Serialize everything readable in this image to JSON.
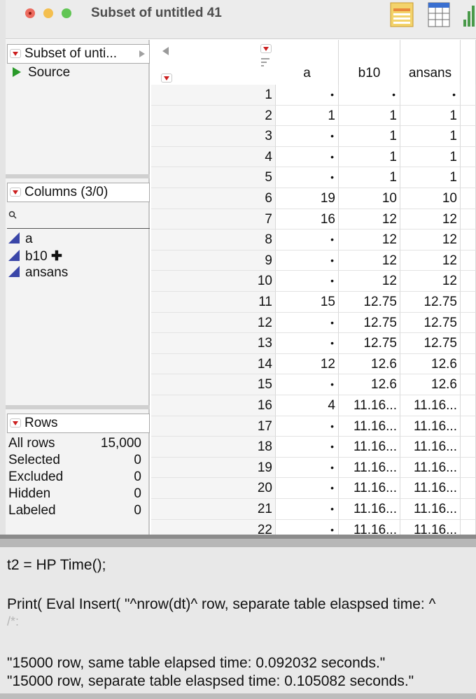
{
  "window": {
    "title": "Subset of untitled 41"
  },
  "left_panel": {
    "table_title": "Subset of unti...",
    "source_label": "Source",
    "columns_title": "Columns (3/0)",
    "columns": [
      {
        "name": "a",
        "suffix": ""
      },
      {
        "name": "b10",
        "suffix": "✚"
      },
      {
        "name": "ansans",
        "suffix": ""
      }
    ],
    "rows_title": "Rows",
    "rows": [
      {
        "label": "All rows",
        "value": "15,000"
      },
      {
        "label": "Selected",
        "value": "0"
      },
      {
        "label": "Excluded",
        "value": "0"
      },
      {
        "label": "Hidden",
        "value": "0"
      },
      {
        "label": "Labeled",
        "value": "0"
      }
    ]
  },
  "grid": {
    "headers": [
      "a",
      "b10",
      "ansans"
    ],
    "rows": [
      [
        "1",
        "•",
        "•",
        "•"
      ],
      [
        "2",
        "1",
        "1",
        "1"
      ],
      [
        "3",
        "•",
        "1",
        "1"
      ],
      [
        "4",
        "•",
        "1",
        "1"
      ],
      [
        "5",
        "•",
        "1",
        "1"
      ],
      [
        "6",
        "19",
        "10",
        "10"
      ],
      [
        "7",
        "16",
        "12",
        "12"
      ],
      [
        "8",
        "•",
        "12",
        "12"
      ],
      [
        "9",
        "•",
        "12",
        "12"
      ],
      [
        "10",
        "•",
        "12",
        "12"
      ],
      [
        "11",
        "15",
        "12.75",
        "12.75"
      ],
      [
        "12",
        "•",
        "12.75",
        "12.75"
      ],
      [
        "13",
        "•",
        "12.75",
        "12.75"
      ],
      [
        "14",
        "12",
        "12.6",
        "12.6"
      ],
      [
        "15",
        "•",
        "12.6",
        "12.6"
      ],
      [
        "16",
        "4",
        "11.16...",
        "11.16..."
      ],
      [
        "17",
        "•",
        "11.16...",
        "11.16..."
      ],
      [
        "18",
        "•",
        "11.16...",
        "11.16..."
      ],
      [
        "19",
        "•",
        "11.16...",
        "11.16..."
      ],
      [
        "20",
        "•",
        "11.16...",
        "11.16..."
      ],
      [
        "21",
        "•",
        "11.16...",
        "11.16..."
      ],
      [
        "22",
        "•",
        "11.16...",
        "11.16..."
      ]
    ]
  },
  "script": {
    "line1": "t2 = HP Time();",
    "line2": "Print( Eval Insert( \"^nrow(dt)^ row, separate table elaspsed time: ^",
    "line3": "/*:",
    "line4": "\"15000 row, same table elapsed time: 0.092032 seconds.\"",
    "line5": "\"15000 row, separate table elaspsed time: 0.105082 seconds.\""
  }
}
